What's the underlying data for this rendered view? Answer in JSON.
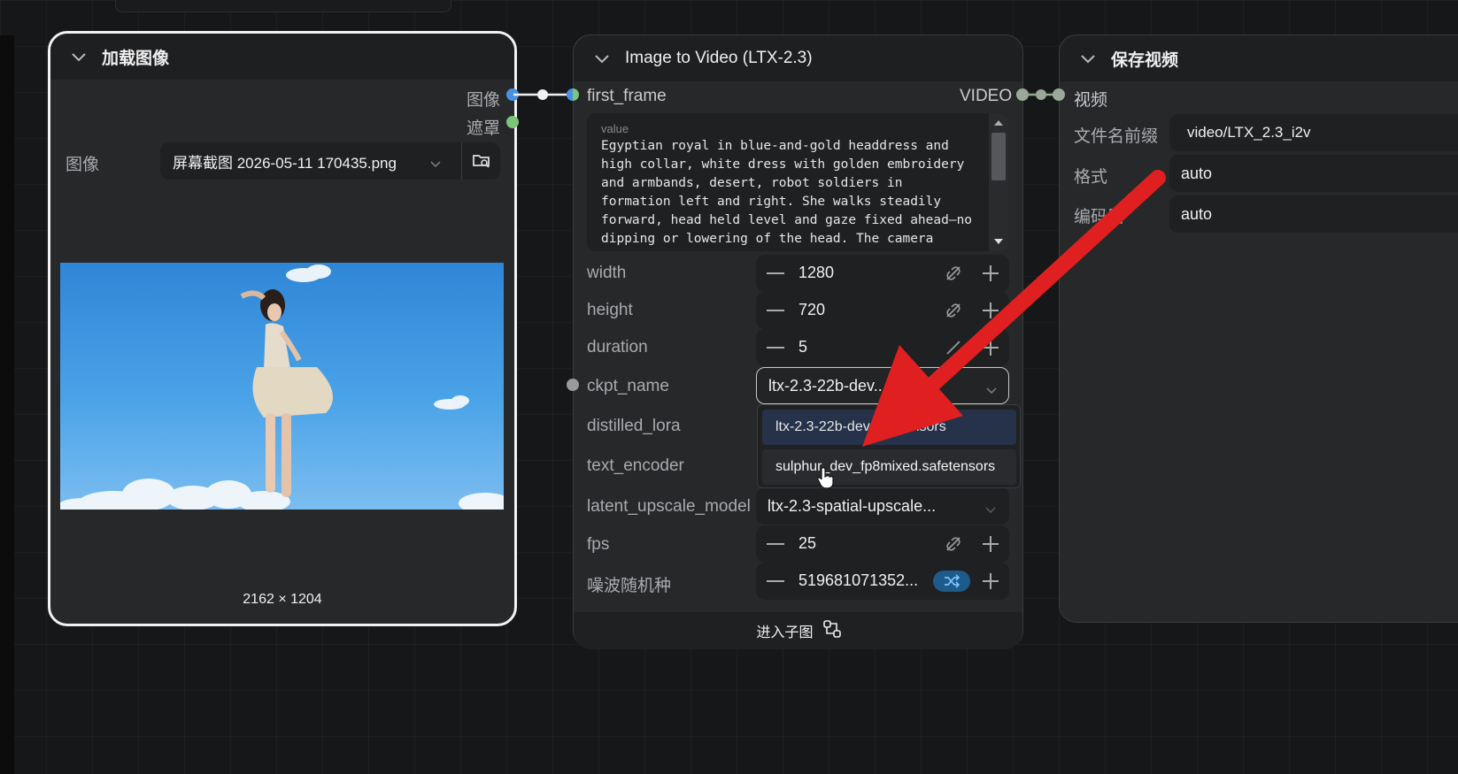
{
  "load_image_node": {
    "title": "加载图像",
    "output_image_label": "图像",
    "output_mask_label": "遮罩",
    "image_param_label": "图像",
    "image_filename": "屏幕截图 2026-05-11 170435.png",
    "image_dimensions": "2162 × 1204"
  },
  "i2v_node": {
    "title": "Image to Video (LTX-2.3)",
    "input_first_frame": "first_frame",
    "output_video": "VIDEO",
    "prompt_header": "value",
    "prompt_text": "Egyptian royal in blue-and-gold headdress and high collar, white dress with golden embroidery and armbands, desert, robot soldiers in formation left and right. She walks steadily forward, head held level and gaze fixed ahead—no dipping or lowering of the head. The camera performs a single, smooth push-",
    "width_label": "width",
    "width_value": "1280",
    "height_label": "height",
    "height_value": "720",
    "duration_label": "duration",
    "duration_value": "5",
    "ckpt_label": "ckpt_name",
    "ckpt_value": "ltx-2.3-22b-dev...",
    "distilled_lora_label": "distilled_lora",
    "text_encoder_label": "text_encoder",
    "latent_upscale_label": "latent_upscale_model",
    "latent_upscale_value": "ltx-2.3-spatial-upscale...",
    "fps_label": "fps",
    "fps_value": "25",
    "seed_label": "噪波随机种",
    "seed_value": "519681071352...",
    "subgraph_label": "进入子图"
  },
  "dropdown": {
    "options": [
      "ltx-2.3-22b-dev.safetensors",
      "sulphur_dev_fp8mixed.safetensors"
    ],
    "highlighted_index": 0
  },
  "save_video_node": {
    "title": "保存视频",
    "input_video_label": "视频",
    "prefix_label": "文件名前缀",
    "prefix_value": "video/LTX_2.3_i2v",
    "format_label": "格式",
    "format_value": "auto",
    "codec_label": "编码器",
    "codec_value": "auto"
  },
  "colors": {
    "image_socket": "#4a90e2",
    "mask_socket": "#7cc47c",
    "video_socket": "#9aa89a",
    "annotation_arrow": "#e02020",
    "seed_toggle": "#1e5a8a"
  }
}
